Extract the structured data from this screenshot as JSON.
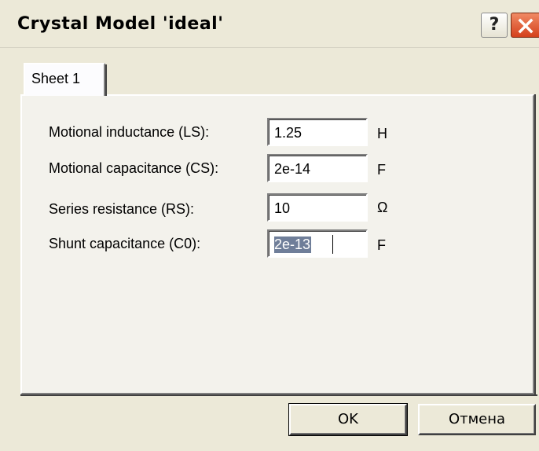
{
  "window": {
    "title": "Crystal Model 'ideal'",
    "help_label": "?",
    "close_icon": "close-icon"
  },
  "tabs": [
    {
      "label": "Sheet 1",
      "active": true
    }
  ],
  "fields": [
    {
      "label": "Motional inductance (LS):",
      "value": "1.25",
      "unit": "H"
    },
    {
      "label": "Motional capacitance (CS):",
      "value": "2e-14",
      "unit": "F"
    },
    {
      "label": "Series resistance (RS):",
      "value": "10",
      "unit": "Ω"
    },
    {
      "label": "Shunt capacitance (C0):",
      "value": "2e-13",
      "unit": "F",
      "selected": true
    }
  ],
  "buttons": {
    "ok": "OK",
    "cancel": "Отмена"
  },
  "colors": {
    "dialog_bg": "#ece9d8",
    "close_button": "#d4401c",
    "selection": "#6f7e99"
  }
}
